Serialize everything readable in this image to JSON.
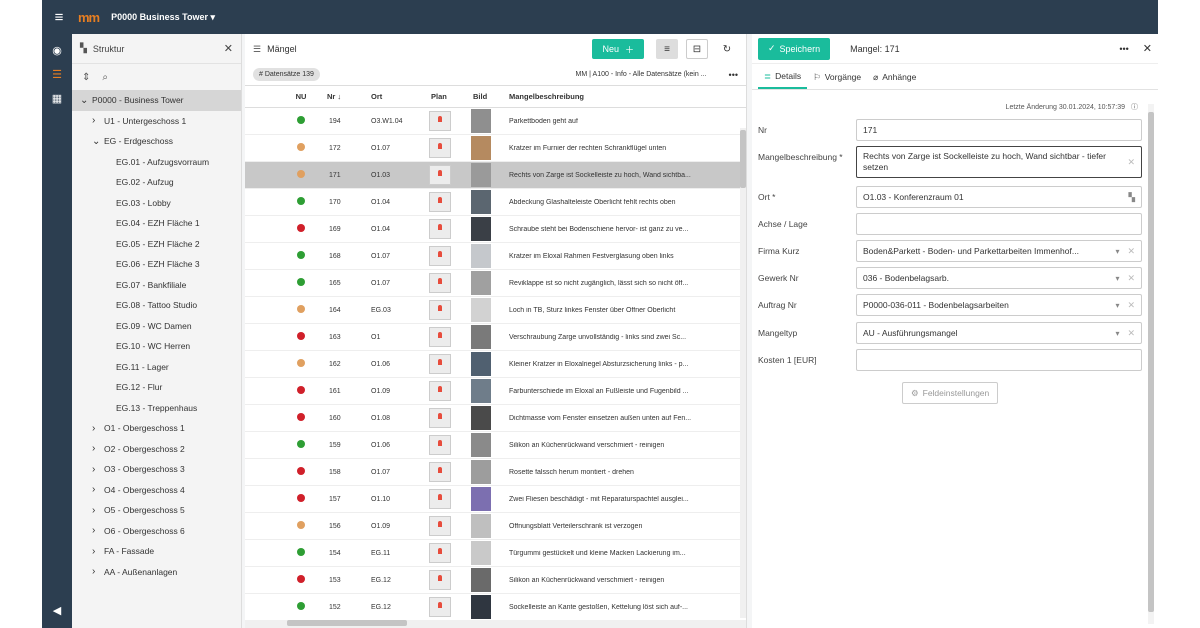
{
  "app": {
    "logo": "mm",
    "project": "P0000 Business Tower",
    "project_caret": "▾",
    "menu_icon": "≡"
  },
  "tree": {
    "title": "Struktur",
    "root": "P0000 - Business Tower",
    "items": [
      {
        "label": "U1 - Untergeschoss 1",
        "level": 1,
        "chev": "›"
      },
      {
        "label": "EG - Erdgeschoss",
        "level": 1,
        "chev": "⌄"
      },
      {
        "label": "EG.01 - Aufzugsvorraum",
        "level": 2,
        "chev": ""
      },
      {
        "label": "EG.02 - Aufzug",
        "level": 2,
        "chev": ""
      },
      {
        "label": "EG.03 - Lobby",
        "level": 2,
        "chev": ""
      },
      {
        "label": "EG.04 - EZH Fläche 1",
        "level": 2,
        "chev": ""
      },
      {
        "label": "EG.05 - EZH Fläche 2",
        "level": 2,
        "chev": ""
      },
      {
        "label": "EG.06 - EZH Fläche 3",
        "level": 2,
        "chev": ""
      },
      {
        "label": "EG.07 - Bankfiliale",
        "level": 2,
        "chev": ""
      },
      {
        "label": "EG.08 - Tattoo Studio",
        "level": 2,
        "chev": ""
      },
      {
        "label": "EG.09 - WC Damen",
        "level": 2,
        "chev": ""
      },
      {
        "label": "EG.10 - WC Herren",
        "level": 2,
        "chev": ""
      },
      {
        "label": "EG.11 - Lager",
        "level": 2,
        "chev": ""
      },
      {
        "label": "EG.12 - Flur",
        "level": 2,
        "chev": ""
      },
      {
        "label": "EG.13 - Treppenhaus",
        "level": 2,
        "chev": ""
      },
      {
        "label": "O1 - Obergeschoss 1",
        "level": 1,
        "chev": "›"
      },
      {
        "label": "O2 - Obergeschoss 2",
        "level": 1,
        "chev": "›"
      },
      {
        "label": "O3 - Obergeschoss 3",
        "level": 1,
        "chev": "›"
      },
      {
        "label": "O4 - Obergeschoss 4",
        "level": 1,
        "chev": "›"
      },
      {
        "label": "O5 - Obergeschoss 5",
        "level": 1,
        "chev": "›"
      },
      {
        "label": "O6 - Obergeschoss 6",
        "level": 1,
        "chev": "›"
      },
      {
        "label": "FA - Fassade",
        "level": 1,
        "chev": "›"
      },
      {
        "label": "AA - Außenanlagen",
        "level": 1,
        "chev": "›"
      }
    ]
  },
  "list": {
    "title": "Mängel",
    "new_label": "Neu",
    "count_label": "# Datensätze 139",
    "info": "MM | A100 - Info - Alle Datensätze (kein ...",
    "more": "•••",
    "columns": {
      "nu": "NU",
      "nr": "Nr ↓",
      "ort": "Ort",
      "plan": "Plan",
      "bild": "Bild",
      "desc": "Mangelbeschreibung"
    },
    "rows": [
      {
        "color": "#2e9e34",
        "nr": "194",
        "ort": "O3.W1.04",
        "desc": "Parkettboden geht auf",
        "img": "#8f8f8f"
      },
      {
        "color": "#e0a060",
        "nr": "172",
        "ort": "O1.07",
        "desc": "Kratzer im Furnier der rechten Schrankflügel unten",
        "img": "#b58a60"
      },
      {
        "color": "#e0a060",
        "nr": "171",
        "ort": "O1.03",
        "desc": "Rechts von Zarge ist Sockelleiste zu hoch, Wand sichtba...",
        "img": "#9a9a9a",
        "sel": true
      },
      {
        "color": "#2e9e34",
        "nr": "170",
        "ort": "O1.04",
        "desc": "Abdeckung Glashalteleiste Oberlicht fehlt rechts oben",
        "img": "#5b6670"
      },
      {
        "color": "#d0202a",
        "nr": "169",
        "ort": "O1.04",
        "desc": "Schraube steht bei Bodenschiene hervor- ist ganz zu ve...",
        "img": "#3a3f46"
      },
      {
        "color": "#2e9e34",
        "nr": "168",
        "ort": "O1.07",
        "desc": "Kratzer im Eloxal Rahmen Festverglasung oben links",
        "img": "#c5c8cc"
      },
      {
        "color": "#2e9e34",
        "nr": "165",
        "ort": "O1.07",
        "desc": "Reviklappe ist so nicht zugänglich, lässt sich so nicht öff...",
        "img": "#a0a0a0"
      },
      {
        "color": "#e0a060",
        "nr": "164",
        "ort": "EG.03",
        "desc": "Loch in TB, Sturz linkes Fenster über Öffner Oberlicht",
        "img": "#d2d2d2"
      },
      {
        "color": "#d0202a",
        "nr": "163",
        "ort": "O1",
        "desc": "Verschraubung Zarge unvollständig - links sind zwei Sc...",
        "img": "#7a7a7a"
      },
      {
        "color": "#e0a060",
        "nr": "162",
        "ort": "O1.06",
        "desc": "Kleiner Kratzer in Eloxalriegel Absturzsicherung links - p...",
        "img": "#506070"
      },
      {
        "color": "#d0202a",
        "nr": "161",
        "ort": "O1.09",
        "desc": "Farbunterschiede im Eloxal an Fußleiste und Fugenbild ...",
        "img": "#6f7d8a"
      },
      {
        "color": "#d0202a",
        "nr": "160",
        "ort": "O1.08",
        "desc": "Dichtmasse vom Fenster einsetzen außen unten auf Fen...",
        "img": "#4a4a4a"
      },
      {
        "color": "#2e9e34",
        "nr": "159",
        "ort": "O1.06",
        "desc": "Silikon an Küchenrückwand verschmiert - reinigen",
        "img": "#8a8a8a"
      },
      {
        "color": "#d0202a",
        "nr": "158",
        "ort": "O1.07",
        "desc": "Rosette falssch herum montiert - drehen",
        "img": "#9d9d9d"
      },
      {
        "color": "#d0202a",
        "nr": "157",
        "ort": "O1.10",
        "desc": "Zwei Fliesen beschädigt - mit Reparaturspachtel ausglei...",
        "img": "#7c6fb0"
      },
      {
        "color": "#e0a060",
        "nr": "156",
        "ort": "O1.09",
        "desc": "Öffnungsblatt Verteilerschrank ist verzogen",
        "img": "#bfbfbf"
      },
      {
        "color": "#2e9e34",
        "nr": "154",
        "ort": "EG.11",
        "desc": "Türgummi gestückelt und kleine Macken Lackierung im...",
        "img": "#c9c9c9"
      },
      {
        "color": "#d0202a",
        "nr": "153",
        "ort": "EG.12",
        "desc": "Silikon an Küchenrückwand verschmiert - reinigen",
        "img": "#6a6a6a"
      },
      {
        "color": "#2e9e34",
        "nr": "152",
        "ort": "EG.12",
        "desc": "Sockelleiste an Kante gestoßen, Kettelung löst sich auf-...",
        "img": "#2f3640"
      }
    ]
  },
  "detail": {
    "save_label": "Speichern",
    "title": "Mangel: 171",
    "more": "•••",
    "close": "✕",
    "tabs": {
      "details": "Details",
      "vorgaenge": "Vorgänge",
      "anhaenge": "Anhänge"
    },
    "last_change": "Letzte Änderung 30.01.2024, 10:57:39",
    "fields": {
      "nr": {
        "label": "Nr",
        "value": "171"
      },
      "desc": {
        "label": "Mangelbeschreibung *",
        "value": "Rechts von Zarge ist Sockelleiste zu hoch, Wand sichtbar - tiefer setzen"
      },
      "ort": {
        "label": "Ort *",
        "value": "O1.03 - Konferenzraum 01"
      },
      "achse": {
        "label": "Achse / Lage",
        "value": ""
      },
      "firma": {
        "label": "Firma Kurz",
        "value": "Boden&Parkett - Boden- und Parkettarbeiten Immenhof..."
      },
      "gewerk": {
        "label": "Gewerk Nr",
        "value": "036 - Bodenbelagsarb."
      },
      "auftrag": {
        "label": "Auftrag Nr",
        "value": "P0000-036-011 - Bodenbelagsarbeiten"
      },
      "mangeltyp": {
        "label": "Mangeltyp",
        "value": "AU - Ausführungsmangel"
      },
      "kosten": {
        "label": "Kosten 1 [EUR]",
        "value": ""
      }
    },
    "feld_label": "Feldeinstellungen"
  }
}
